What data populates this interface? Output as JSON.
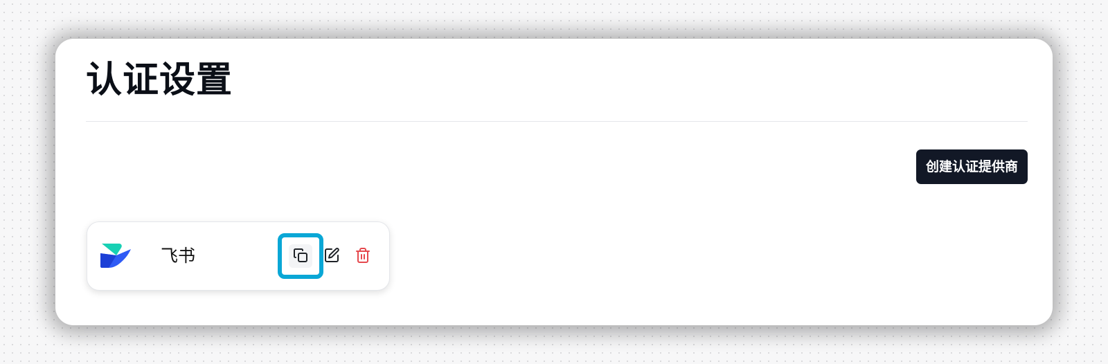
{
  "page": {
    "title": "认证设置"
  },
  "toolbar": {
    "create_provider_label": "创建认证提供商"
  },
  "providers": [
    {
      "name": "飞书",
      "logo_icon": "feishu-logo-icon",
      "actions": [
        {
          "icon": "copy-icon",
          "highlighted": true
        },
        {
          "icon": "edit-icon",
          "highlighted": false
        },
        {
          "icon": "trash-icon",
          "highlighted": false
        }
      ]
    }
  ],
  "colors": {
    "primary_button_bg": "#121826",
    "highlight_border": "#0aa7d6",
    "delete_icon": "#e5484d",
    "logo_teal": "#18d0b4",
    "logo_blue": "#2f5bf5"
  }
}
